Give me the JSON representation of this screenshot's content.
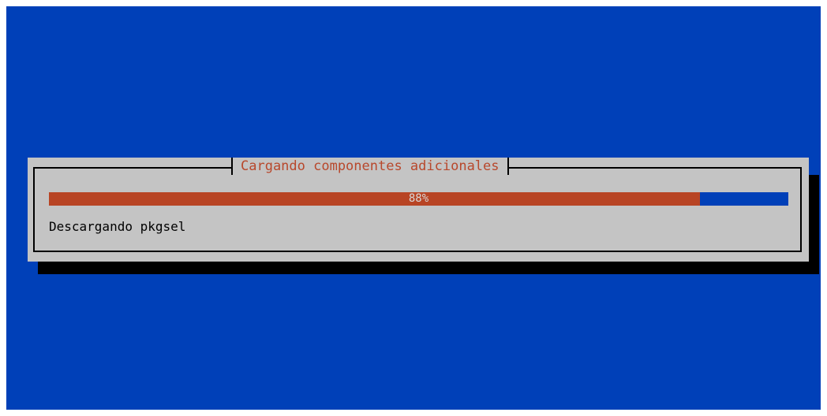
{
  "dialog": {
    "title": "Cargando componentes adicionales",
    "progress": {
      "percent": 88,
      "label": "88%"
    },
    "status_text": "Descargando pkgsel"
  },
  "colors": {
    "background": "#0040b8",
    "dialog": "#c4c4c4",
    "title_text": "#b8482c",
    "progress_fill": "#b84424",
    "progress_track": "#0040b8",
    "shadow": "#000000"
  }
}
